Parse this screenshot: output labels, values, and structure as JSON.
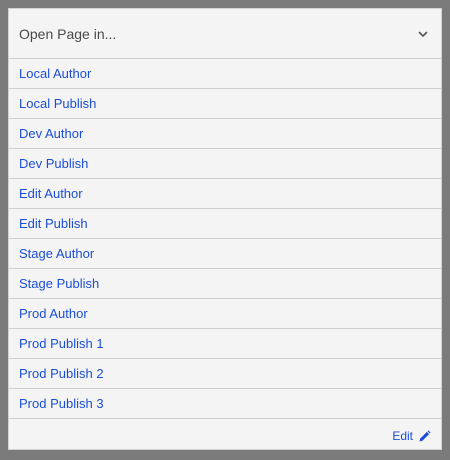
{
  "header": {
    "label": "Open Page in...",
    "chevron_icon": "chevron-down-icon"
  },
  "items": [
    {
      "label": "Local Author"
    },
    {
      "label": "Local Publish"
    },
    {
      "label": "Dev Author"
    },
    {
      "label": "Dev Publish"
    },
    {
      "label": "Edit Author"
    },
    {
      "label": "Edit Publish"
    },
    {
      "label": "Stage Author"
    },
    {
      "label": "Stage Publish"
    },
    {
      "label": "Prod Author"
    },
    {
      "label": "Prod Publish 1"
    },
    {
      "label": "Prod Publish 2"
    },
    {
      "label": "Prod Publish 3"
    }
  ],
  "footer": {
    "edit_label": "Edit",
    "edit_icon": "pencil-icon"
  },
  "colors": {
    "link": "#1b4ed8",
    "panel_bg": "#f4f4f4",
    "page_bg": "#7b7b7b"
  }
}
